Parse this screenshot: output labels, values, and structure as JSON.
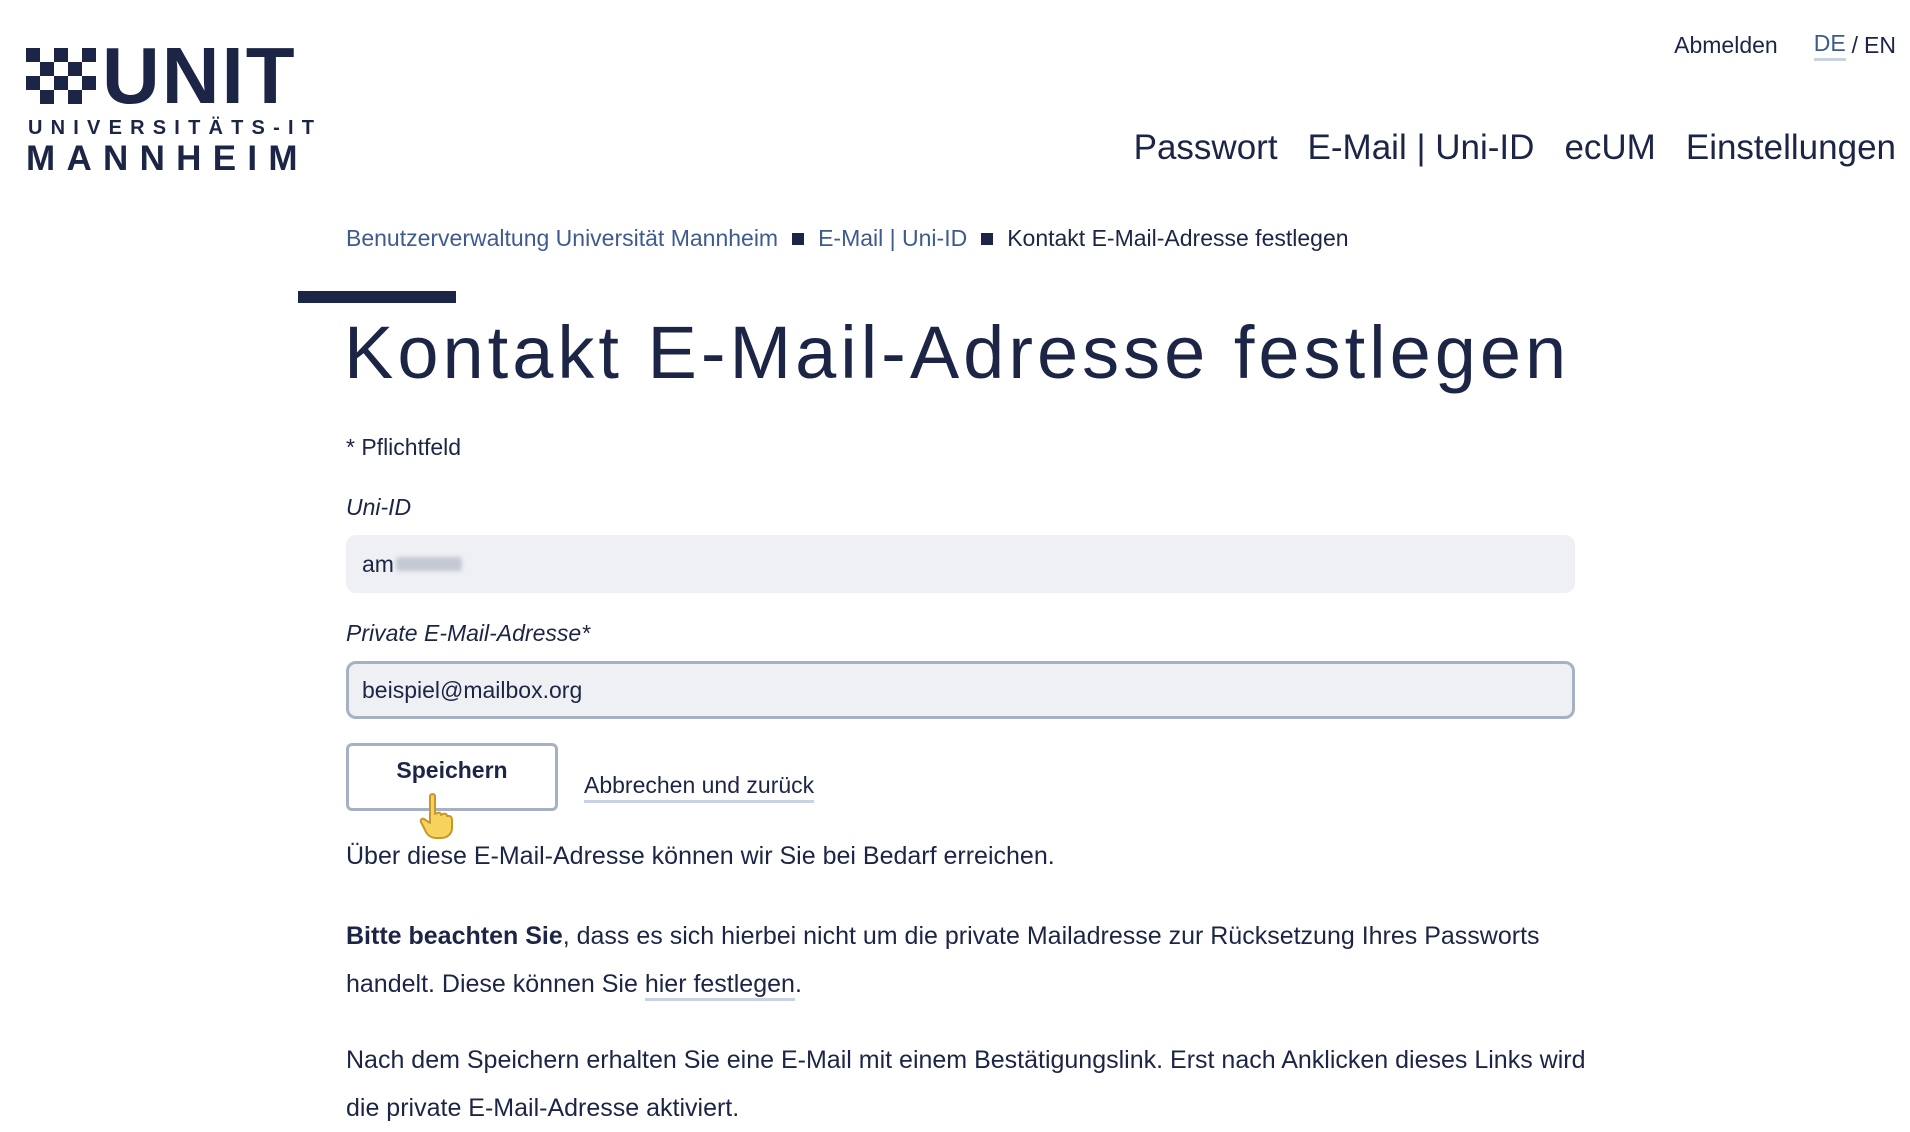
{
  "logo": {
    "brand": "UNIT",
    "line1": "UNIVERSITÄTS-IT",
    "line2": "MANNHEIM"
  },
  "topbar": {
    "logout": "Abmelden",
    "lang_de": "DE",
    "lang_separator": "/",
    "lang_en": "EN"
  },
  "nav": {
    "items": [
      {
        "label": "Passwort"
      },
      {
        "label": "E-Mail | Uni-ID"
      },
      {
        "label": "ecUM"
      },
      {
        "label": "Einstellungen"
      }
    ]
  },
  "breadcrumb": {
    "items": [
      {
        "label": "Benutzerverwaltung Universität Mannheim"
      },
      {
        "label": "E-Mail | Uni-ID"
      },
      {
        "label": "Kontakt E-Mail-Adresse festlegen"
      }
    ]
  },
  "page": {
    "title": "Kontakt E-Mail-Adresse festlegen",
    "required_note": "* Pflichtfeld"
  },
  "form": {
    "uniid_label": "Uni-ID",
    "uniid_value": "am",
    "email_label": "Private E-Mail-Adresse*",
    "email_value": "beispiel@mailbox.org",
    "save_label": "Speichern",
    "cancel_label": "Abbrechen und zurück"
  },
  "info": {
    "text1": "Über diese E-Mail-Adresse können wir Sie bei Bedarf erreichen.",
    "text2_bold": "Bitte beachten Sie",
    "text2_part1": ", dass es sich hierbei nicht um die private Mailadresse zur Rücksetzung Ihres Passworts handelt. Diese können Sie ",
    "text2_link": "hier festlegen",
    "text2_end": ".",
    "text3": "Nach dem Speichern erhalten Sie eine E-Mail mit einem Bestätigungslink. Erst nach Anklicken dieses Links wird die private E-Mail-Adresse aktiviert."
  },
  "colors": {
    "primary": "#1c2546",
    "link": "#3e5b8f",
    "field_bg": "#eef0f4",
    "border": "#a7b1c4"
  }
}
